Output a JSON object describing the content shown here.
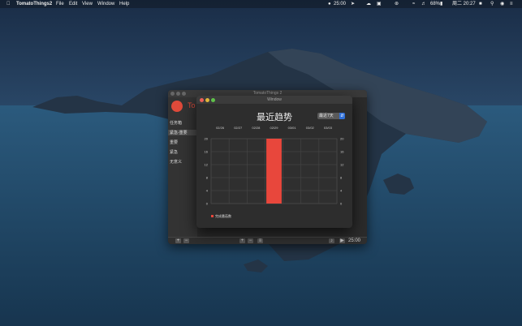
{
  "menubar": {
    "app_name": "TomatoThings2",
    "menus": [
      "File",
      "Edit",
      "View",
      "Window",
      "Help"
    ],
    "timer": "25:00",
    "battery": "68%",
    "clock": "周二 20:27"
  },
  "main_window": {
    "title": "TomatoThings 2",
    "app_label": "To",
    "sidebar_items": [
      "任务箱",
      "紧急-重要",
      "重要",
      "紧急",
      "无意义"
    ],
    "timer": "25:00"
  },
  "trend_window": {
    "title": "Window",
    "heading": "最近趋势",
    "range_select": "最近7天",
    "colors": {
      "bar": "#e8473c",
      "accent": "#2f6fd8"
    }
  },
  "chart_data": {
    "type": "bar",
    "title": "",
    "categories": [
      "02/26",
      "02/27",
      "02/28",
      "02/29",
      "03/01",
      "03/02",
      "03/03"
    ],
    "series": [
      {
        "name": "完成番茄数",
        "values": [
          0,
          0,
          0,
          20,
          0,
          0,
          0
        ]
      }
    ],
    "yticks": [
      0,
      4,
      8,
      12,
      16,
      20
    ],
    "ylim": [
      0,
      20
    ],
    "grid": true,
    "legend": "bottom-left"
  }
}
